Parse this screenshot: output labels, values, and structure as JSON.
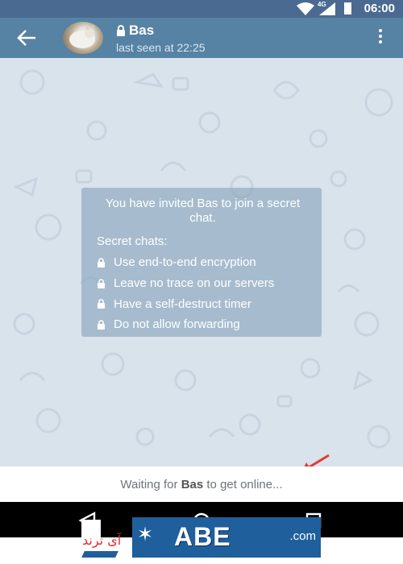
{
  "status_bar": {
    "time": "06:00",
    "network": "4G"
  },
  "header": {
    "title": "Bas",
    "subtitle": "last seen at 22:25"
  },
  "info_box": {
    "title": "You have invited Bas to join a secret chat.",
    "heading": "Secret chats:",
    "features": [
      "Use end-to-end encryption",
      "Leave no trace on our servers",
      "Have a self-destruct timer",
      "Do not allow forwarding"
    ]
  },
  "footer": {
    "prefix": "Waiting for ",
    "name": "Bas",
    "suffix": " to get online..."
  },
  "watermark": {
    "arabic_text": "آی ترند",
    "dotcom": ".com"
  },
  "colors": {
    "status_bar": "#4a6a91",
    "app_bar": "#5682a3",
    "chat_background": "#d9e3ec",
    "info_box": "#7c9cb6",
    "arrow": "#e53935"
  }
}
